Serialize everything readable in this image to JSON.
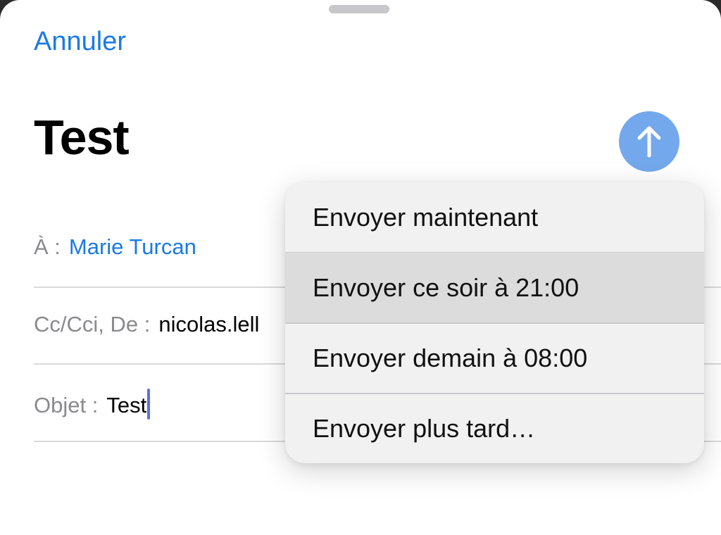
{
  "header": {
    "cancel_label": "Annuler",
    "title": "Test"
  },
  "fields": {
    "to_label": "À :",
    "to_value": "Marie Turcan",
    "cc_label": "Cc/Cci, De :",
    "cc_value": "nicolas.lell",
    "subject_label": "Objet :",
    "subject_value": "Test"
  },
  "send_menu": {
    "items": [
      {
        "label": "Envoyer maintenant",
        "highlighted": false
      },
      {
        "label": "Envoyer ce soir à 21:00",
        "highlighted": true
      },
      {
        "label": "Envoyer demain à 08:00",
        "highlighted": false
      },
      {
        "label": "Envoyer plus tard…",
        "highlighted": false
      }
    ]
  },
  "colors": {
    "accent": "#1a7ae6",
    "send_button": "#74a8ec",
    "menu_bg": "#f1f1f2",
    "menu_highlight": "#dcdcdd"
  },
  "icons": {
    "send": "arrow-up-icon"
  }
}
